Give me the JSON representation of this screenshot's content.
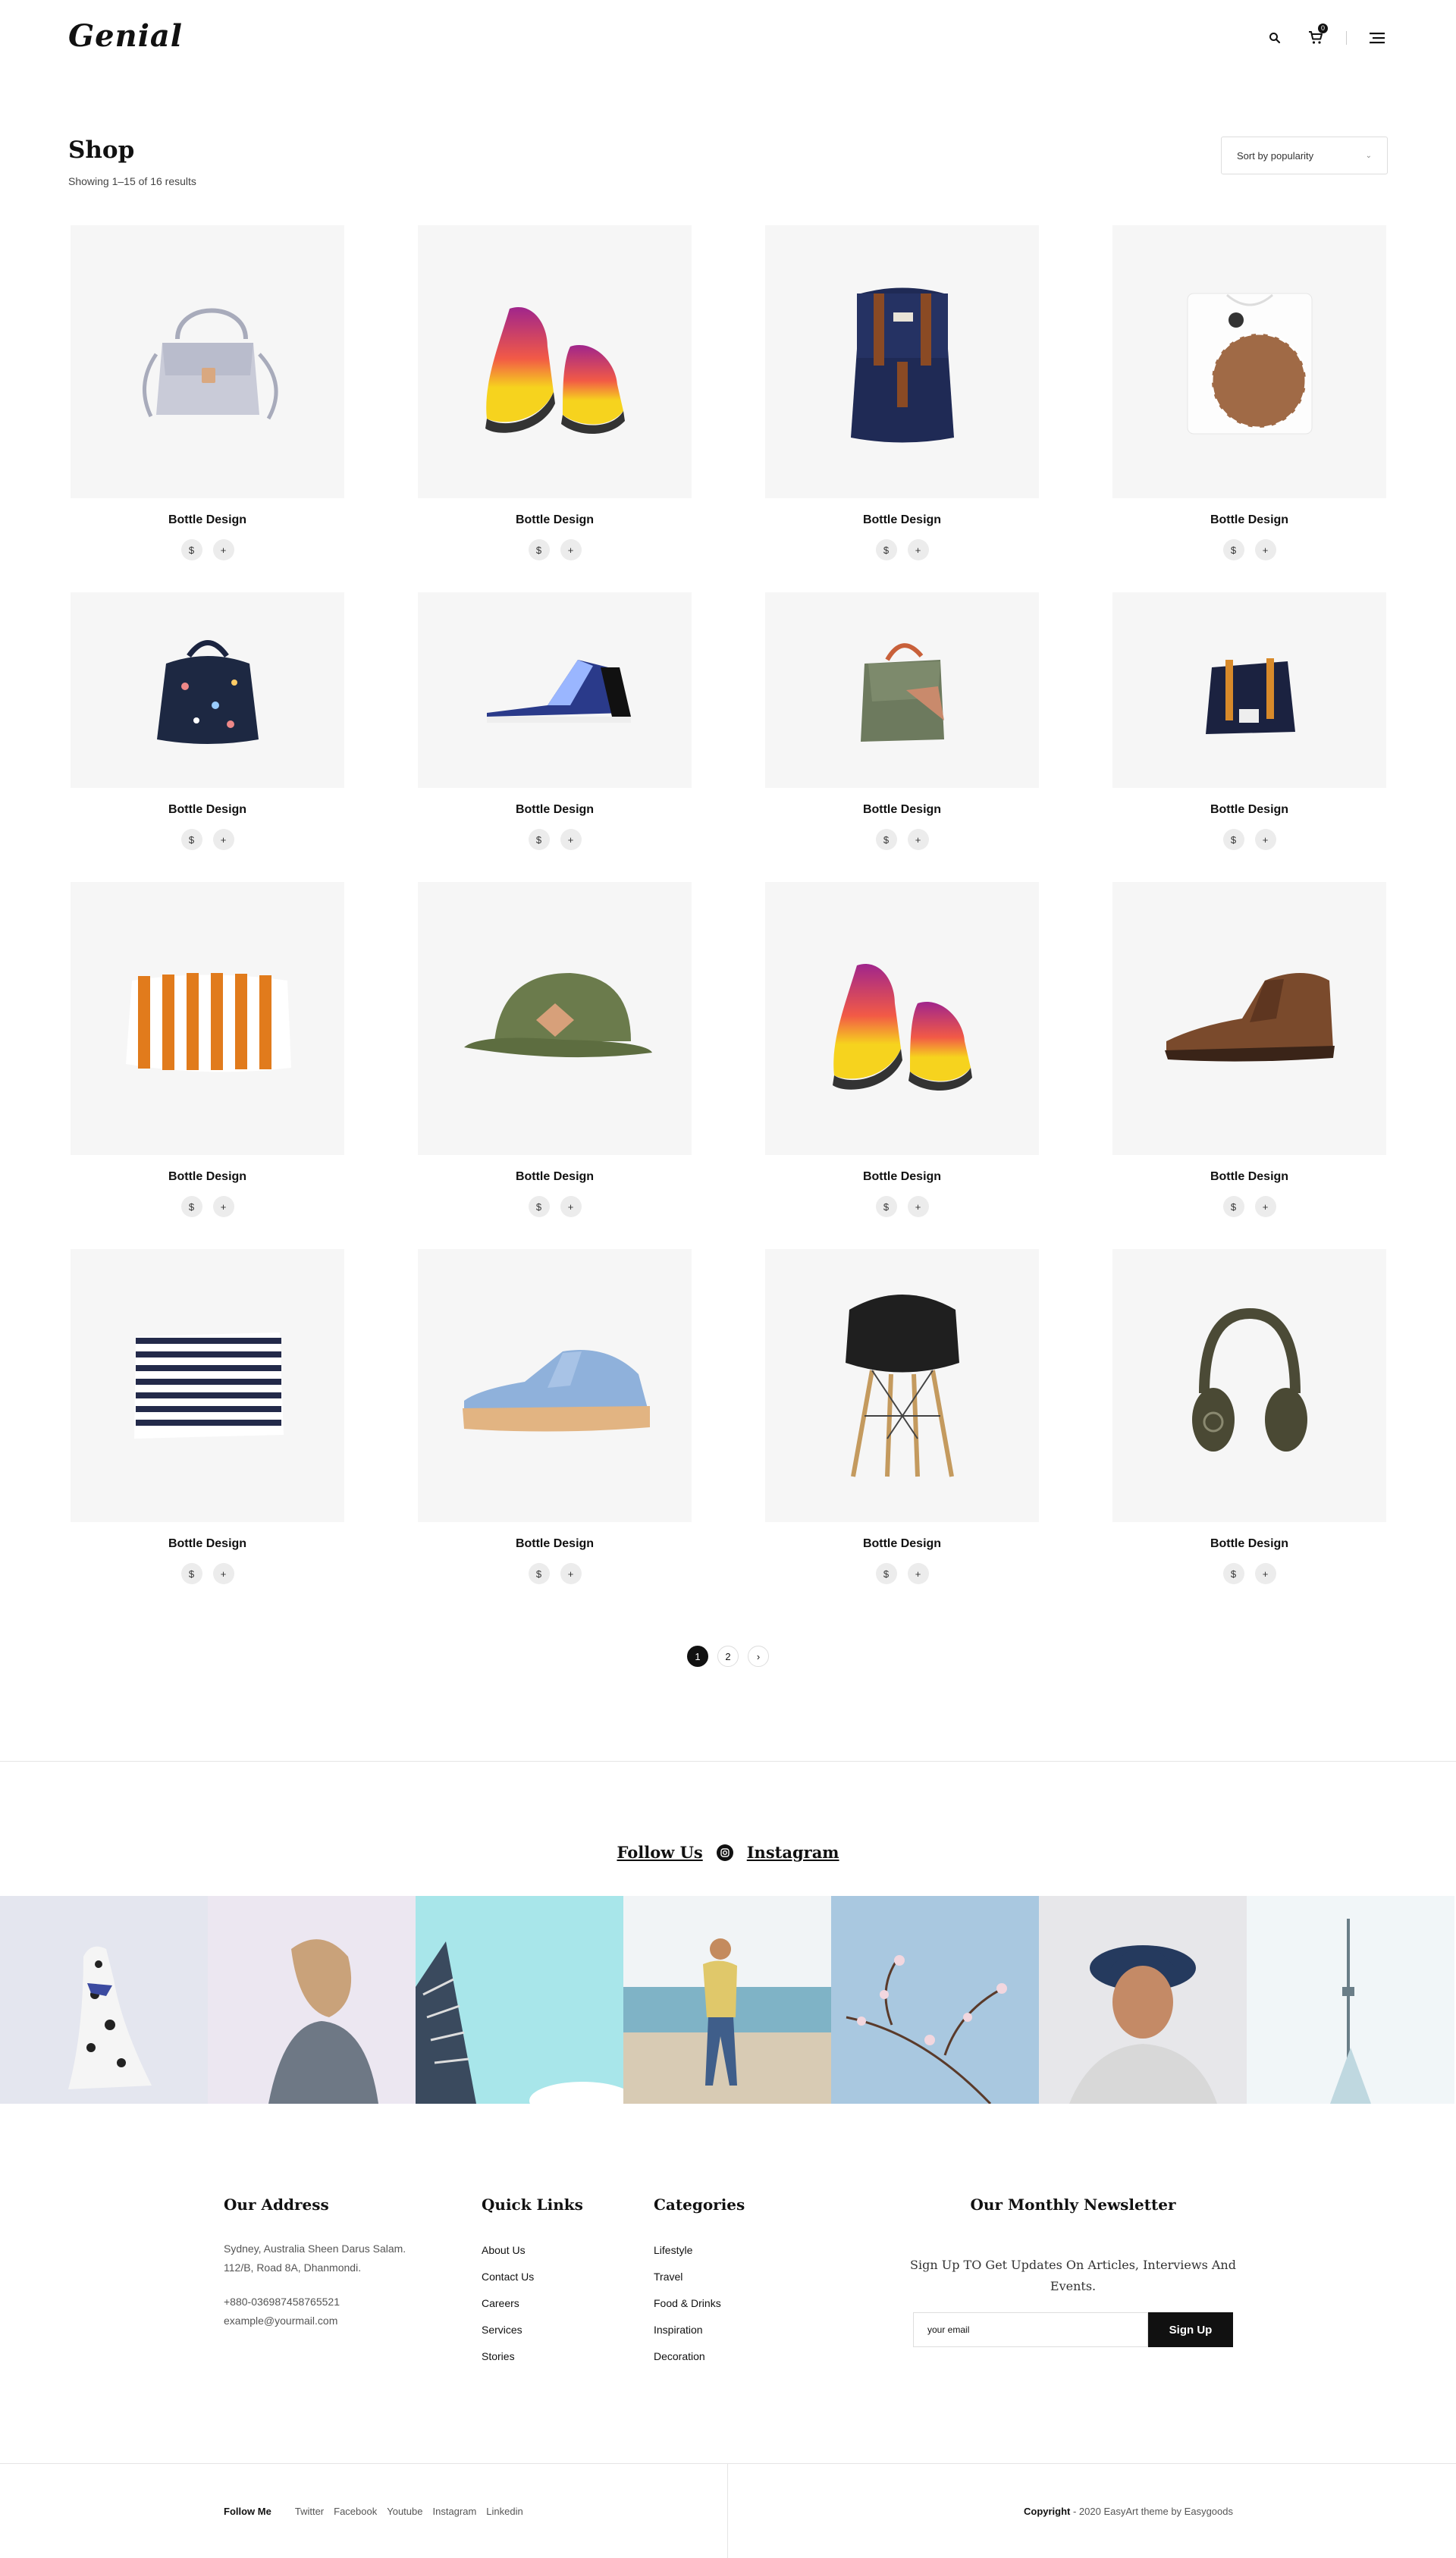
{
  "brand": {
    "logo": "Genial"
  },
  "header": {
    "cart_count": "0"
  },
  "shop": {
    "title": "Shop",
    "result_count": "Showing 1–15 of 16 results",
    "sort_label": "Sort by popularity"
  },
  "products": [
    {
      "name": "Bottle Design",
      "image": "grey-handbag"
    },
    {
      "name": "Bottle Design",
      "image": "yellow-purple-sneakers"
    },
    {
      "name": "Bottle Design",
      "image": "navy-backpack"
    },
    {
      "name": "Bottle Design",
      "image": "folded-tshirt"
    },
    {
      "name": "Bottle Design",
      "image": "patterned-backpack"
    },
    {
      "name": "Bottle Design",
      "image": "blue-sneaker"
    },
    {
      "name": "Bottle Design",
      "image": "green-messenger-bag"
    },
    {
      "name": "Bottle Design",
      "image": "navy-tote-bag"
    },
    {
      "name": "Bottle Design",
      "image": "striped-orange-pouch"
    },
    {
      "name": "Bottle Design",
      "image": "green-cap"
    },
    {
      "name": "Bottle Design",
      "image": "yellow-purple-sneakers"
    },
    {
      "name": "Bottle Design",
      "image": "brown-suede-shoe"
    },
    {
      "name": "Bottle Design",
      "image": "striped-navy-clutch"
    },
    {
      "name": "Bottle Design",
      "image": "blue-platform-sneaker"
    },
    {
      "name": "Bottle Design",
      "image": "black-chair"
    },
    {
      "name": "Bottle Design",
      "image": "green-headphones"
    }
  ],
  "product_buttons": {
    "price": "$",
    "add": "+"
  },
  "pagination": {
    "pages": [
      "1",
      "2"
    ],
    "next": "›",
    "current": "1"
  },
  "instagram": {
    "follow_label": "Follow Us",
    "instagram_label": "Instagram",
    "photos": [
      "dalmatian",
      "woman-hair",
      "building",
      "beach-girl",
      "blossom",
      "man-hat",
      "tower"
    ]
  },
  "footer": {
    "address": {
      "title": "Our Address",
      "line1": "Sydney, Australia Sheen Darus Salam.",
      "line2": "112/B, Road 8A, Dhanmondi.",
      "phone": "+880-036987458765521",
      "email": "example@yourmail.com"
    },
    "quick_links": {
      "title": "Quick Links",
      "items": [
        "About Us",
        "Contact Us",
        "Careers",
        "Services",
        "Stories"
      ]
    },
    "categories": {
      "title": "Categories",
      "items": [
        "Lifestyle",
        "Travel",
        "Food & Drinks",
        "Inspiration",
        "Decoration"
      ]
    },
    "newsletter": {
      "title": "Our Monthly Newsletter",
      "subtitle": "Sign Up TO Get Updates On Articles, Interviews And Events.",
      "placeholder": "your email",
      "button": "Sign Up"
    }
  },
  "bottom": {
    "follow_me": "Follow Me",
    "social": [
      "Twitter",
      "Facebook",
      "Youtube",
      "Instagram",
      "Linkedin"
    ],
    "copyright_label": "Copyright",
    "copyright_text": " - 2020 EasyArt theme by Easygoods"
  }
}
